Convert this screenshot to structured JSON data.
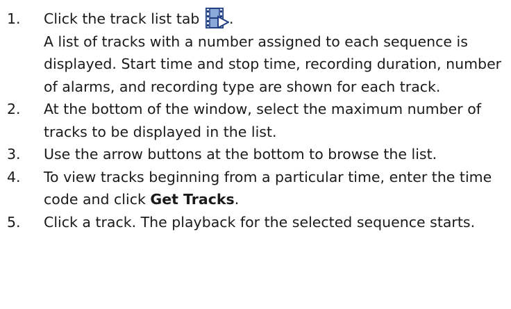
{
  "steps": [
    {
      "number": "1.",
      "text_before_icon": "Click the track list tab",
      "icon": "film-play-icon",
      "text_after_icon": ".",
      "description": "A list of tracks with a number assigned to each sequence is displayed. Start time and stop time, recording duration, number of alarms, and recording type are shown for each track."
    },
    {
      "number": "2.",
      "text": "At the bottom of the window, select the maximum number of tracks to be displayed in the list."
    },
    {
      "number": "3.",
      "text": "Use the arrow buttons at the bottom to browse the list."
    },
    {
      "number": "4.",
      "text_before_bold": "To view tracks beginning from a particular time, enter the time code and click",
      "bold": "Get Tracks",
      "text_after_bold": "."
    },
    {
      "number": "5.",
      "text": "Click a track. The playback for the selected sequence starts."
    }
  ],
  "colors": {
    "text": "#1a1a1a",
    "icon_fill": "#8aa8d8",
    "icon_border": "#1f3f80"
  }
}
